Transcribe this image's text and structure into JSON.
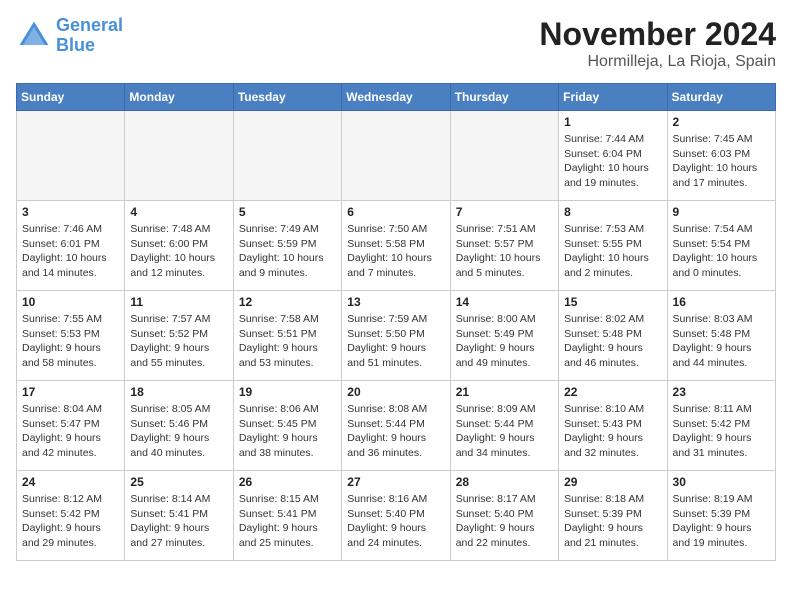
{
  "logo": {
    "line1": "General",
    "line2": "Blue"
  },
  "title": "November 2024",
  "location": "Hormilleja, La Rioja, Spain",
  "weekdays": [
    "Sunday",
    "Monday",
    "Tuesday",
    "Wednesday",
    "Thursday",
    "Friday",
    "Saturday"
  ],
  "weeks": [
    [
      {
        "day": "",
        "info": "",
        "empty": true
      },
      {
        "day": "",
        "info": "",
        "empty": true
      },
      {
        "day": "",
        "info": "",
        "empty": true
      },
      {
        "day": "",
        "info": "",
        "empty": true
      },
      {
        "day": "",
        "info": "",
        "empty": true
      },
      {
        "day": "1",
        "info": "Sunrise: 7:44 AM\nSunset: 6:04 PM\nDaylight: 10 hours and 19 minutes.",
        "empty": false
      },
      {
        "day": "2",
        "info": "Sunrise: 7:45 AM\nSunset: 6:03 PM\nDaylight: 10 hours and 17 minutes.",
        "empty": false
      }
    ],
    [
      {
        "day": "3",
        "info": "Sunrise: 7:46 AM\nSunset: 6:01 PM\nDaylight: 10 hours and 14 minutes.",
        "empty": false
      },
      {
        "day": "4",
        "info": "Sunrise: 7:48 AM\nSunset: 6:00 PM\nDaylight: 10 hours and 12 minutes.",
        "empty": false
      },
      {
        "day": "5",
        "info": "Sunrise: 7:49 AM\nSunset: 5:59 PM\nDaylight: 10 hours and 9 minutes.",
        "empty": false
      },
      {
        "day": "6",
        "info": "Sunrise: 7:50 AM\nSunset: 5:58 PM\nDaylight: 10 hours and 7 minutes.",
        "empty": false
      },
      {
        "day": "7",
        "info": "Sunrise: 7:51 AM\nSunset: 5:57 PM\nDaylight: 10 hours and 5 minutes.",
        "empty": false
      },
      {
        "day": "8",
        "info": "Sunrise: 7:53 AM\nSunset: 5:55 PM\nDaylight: 10 hours and 2 minutes.",
        "empty": false
      },
      {
        "day": "9",
        "info": "Sunrise: 7:54 AM\nSunset: 5:54 PM\nDaylight: 10 hours and 0 minutes.",
        "empty": false
      }
    ],
    [
      {
        "day": "10",
        "info": "Sunrise: 7:55 AM\nSunset: 5:53 PM\nDaylight: 9 hours and 58 minutes.",
        "empty": false
      },
      {
        "day": "11",
        "info": "Sunrise: 7:57 AM\nSunset: 5:52 PM\nDaylight: 9 hours and 55 minutes.",
        "empty": false
      },
      {
        "day": "12",
        "info": "Sunrise: 7:58 AM\nSunset: 5:51 PM\nDaylight: 9 hours and 53 minutes.",
        "empty": false
      },
      {
        "day": "13",
        "info": "Sunrise: 7:59 AM\nSunset: 5:50 PM\nDaylight: 9 hours and 51 minutes.",
        "empty": false
      },
      {
        "day": "14",
        "info": "Sunrise: 8:00 AM\nSunset: 5:49 PM\nDaylight: 9 hours and 49 minutes.",
        "empty": false
      },
      {
        "day": "15",
        "info": "Sunrise: 8:02 AM\nSunset: 5:48 PM\nDaylight: 9 hours and 46 minutes.",
        "empty": false
      },
      {
        "day": "16",
        "info": "Sunrise: 8:03 AM\nSunset: 5:48 PM\nDaylight: 9 hours and 44 minutes.",
        "empty": false
      }
    ],
    [
      {
        "day": "17",
        "info": "Sunrise: 8:04 AM\nSunset: 5:47 PM\nDaylight: 9 hours and 42 minutes.",
        "empty": false
      },
      {
        "day": "18",
        "info": "Sunrise: 8:05 AM\nSunset: 5:46 PM\nDaylight: 9 hours and 40 minutes.",
        "empty": false
      },
      {
        "day": "19",
        "info": "Sunrise: 8:06 AM\nSunset: 5:45 PM\nDaylight: 9 hours and 38 minutes.",
        "empty": false
      },
      {
        "day": "20",
        "info": "Sunrise: 8:08 AM\nSunset: 5:44 PM\nDaylight: 9 hours and 36 minutes.",
        "empty": false
      },
      {
        "day": "21",
        "info": "Sunrise: 8:09 AM\nSunset: 5:44 PM\nDaylight: 9 hours and 34 minutes.",
        "empty": false
      },
      {
        "day": "22",
        "info": "Sunrise: 8:10 AM\nSunset: 5:43 PM\nDaylight: 9 hours and 32 minutes.",
        "empty": false
      },
      {
        "day": "23",
        "info": "Sunrise: 8:11 AM\nSunset: 5:42 PM\nDaylight: 9 hours and 31 minutes.",
        "empty": false
      }
    ],
    [
      {
        "day": "24",
        "info": "Sunrise: 8:12 AM\nSunset: 5:42 PM\nDaylight: 9 hours and 29 minutes.",
        "empty": false
      },
      {
        "day": "25",
        "info": "Sunrise: 8:14 AM\nSunset: 5:41 PM\nDaylight: 9 hours and 27 minutes.",
        "empty": false
      },
      {
        "day": "26",
        "info": "Sunrise: 8:15 AM\nSunset: 5:41 PM\nDaylight: 9 hours and 25 minutes.",
        "empty": false
      },
      {
        "day": "27",
        "info": "Sunrise: 8:16 AM\nSunset: 5:40 PM\nDaylight: 9 hours and 24 minutes.",
        "empty": false
      },
      {
        "day": "28",
        "info": "Sunrise: 8:17 AM\nSunset: 5:40 PM\nDaylight: 9 hours and 22 minutes.",
        "empty": false
      },
      {
        "day": "29",
        "info": "Sunrise: 8:18 AM\nSunset: 5:39 PM\nDaylight: 9 hours and 21 minutes.",
        "empty": false
      },
      {
        "day": "30",
        "info": "Sunrise: 8:19 AM\nSunset: 5:39 PM\nDaylight: 9 hours and 19 minutes.",
        "empty": false
      }
    ]
  ]
}
